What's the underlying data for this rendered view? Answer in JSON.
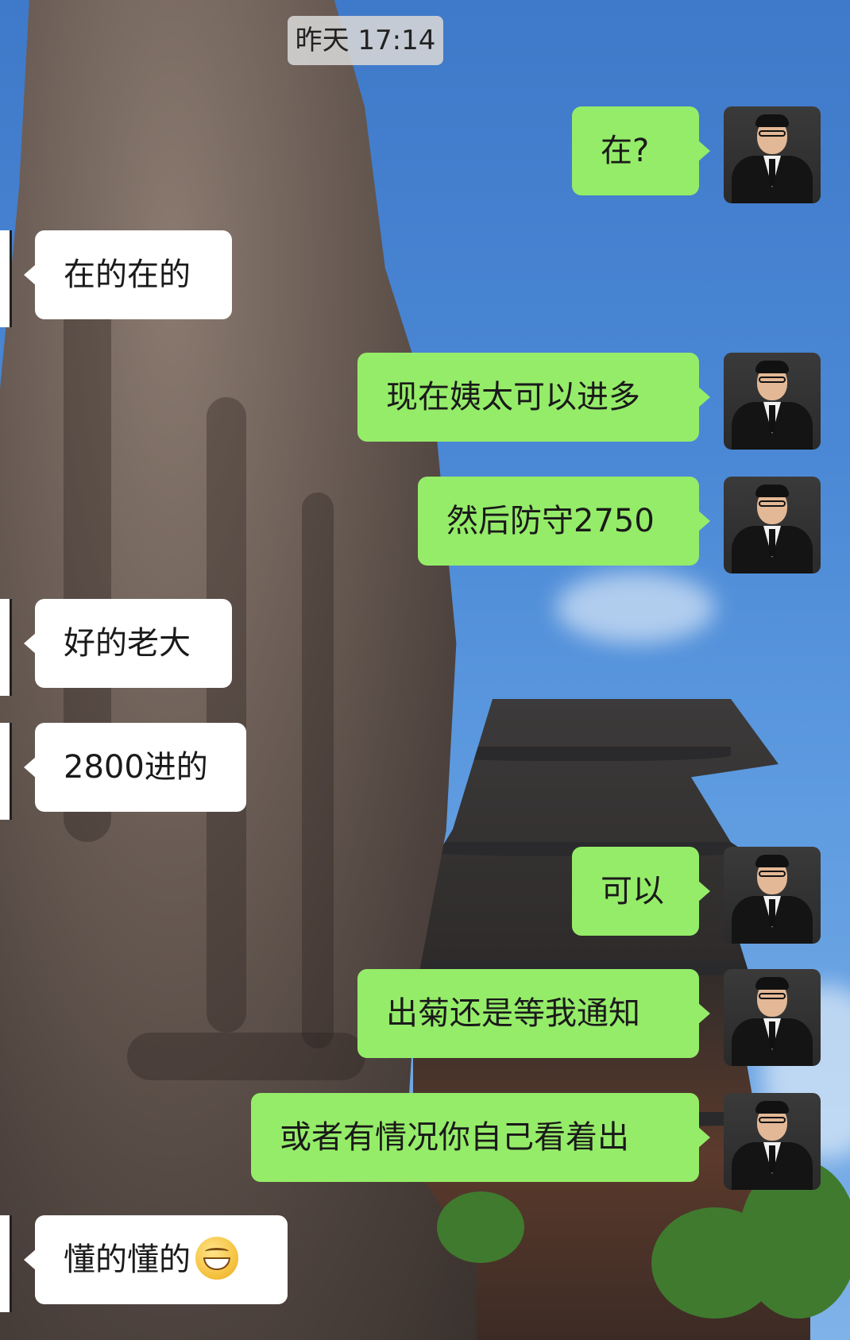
{
  "timestamp": "昨天 17:14",
  "messages": [
    {
      "side": "out",
      "text": "在?"
    },
    {
      "side": "in",
      "text": "在的在的"
    },
    {
      "side": "out",
      "text": "现在姨太可以进多"
    },
    {
      "side": "out",
      "text": "然后防守2750"
    },
    {
      "side": "in",
      "text": "好的老大"
    },
    {
      "side": "in",
      "text": "2800进的"
    },
    {
      "side": "out",
      "text": "可以"
    },
    {
      "side": "out",
      "text": "出菊还是等我通知"
    },
    {
      "side": "out",
      "text": "或者有情况你自己看着出"
    },
    {
      "side": "in",
      "text": "懂的懂的",
      "emoji": "grinning-face-emoji"
    }
  ],
  "colors": {
    "outgoing_bubble": "#95ec69",
    "incoming_bubble": "#ffffff",
    "timestamp_bg": "#d6d6d6"
  }
}
